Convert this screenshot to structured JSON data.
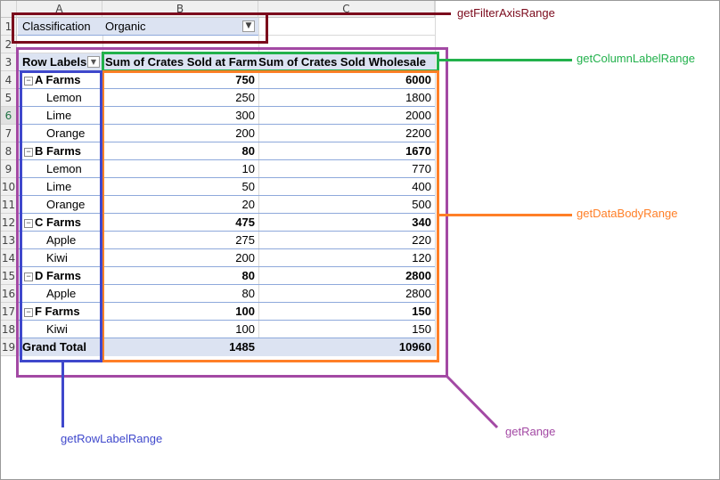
{
  "sheet": {
    "columns": [
      "A",
      "B",
      "C"
    ],
    "rows": [
      "1",
      "2",
      "3",
      "4",
      "5",
      "6",
      "7",
      "8",
      "9",
      "10",
      "11",
      "12",
      "13",
      "14",
      "15",
      "16",
      "17",
      "18",
      "19"
    ],
    "filter": {
      "label": "Classification",
      "value": "Organic",
      "button_icon": "filter-dropdown-icon"
    },
    "header": {
      "row_labels": "Row Labels",
      "col1": "Sum of Crates Sold at Farm",
      "col2": "Sum of Crates Sold Wholesale"
    },
    "body": [
      {
        "label": "A Farms",
        "farm": "750",
        "wholesale": "6000",
        "group": true
      },
      {
        "label": "Lemon",
        "farm": "250",
        "wholesale": "1800"
      },
      {
        "label": "Lime",
        "farm": "300",
        "wholesale": "2000"
      },
      {
        "label": "Orange",
        "farm": "200",
        "wholesale": "2200"
      },
      {
        "label": "B Farms",
        "farm": "80",
        "wholesale": "1670",
        "group": true
      },
      {
        "label": "Lemon",
        "farm": "10",
        "wholesale": "770"
      },
      {
        "label": "Lime",
        "farm": "50",
        "wholesale": "400"
      },
      {
        "label": "Orange",
        "farm": "20",
        "wholesale": "500"
      },
      {
        "label": "C Farms",
        "farm": "475",
        "wholesale": "340",
        "group": true
      },
      {
        "label": "Apple",
        "farm": "275",
        "wholesale": "220"
      },
      {
        "label": "Kiwi",
        "farm": "200",
        "wholesale": "120"
      },
      {
        "label": "D Farms",
        "farm": "80",
        "wholesale": "2800",
        "group": true
      },
      {
        "label": "Apple",
        "farm": "80",
        "wholesale": "2800"
      },
      {
        "label": "F Farms",
        "farm": "100",
        "wholesale": "150",
        "group": true
      },
      {
        "label": "Kiwi",
        "farm": "100",
        "wholesale": "150"
      }
    ],
    "grand_total": {
      "label": "Grand Total",
      "farm": "1485",
      "wholesale": "10960"
    }
  },
  "annotations": {
    "filter": {
      "label": "getFilterAxisRange",
      "color": "#7b0a1c"
    },
    "range": {
      "label": "getRange",
      "color": "#a349a4"
    },
    "column": {
      "label": "getColumnLabelRange",
      "color": "#22b14c"
    },
    "body": {
      "label": "getDataBodyRange",
      "color": "#ff7f27"
    },
    "row": {
      "label": "getRowLabelRange",
      "color": "#3f48cc"
    }
  }
}
